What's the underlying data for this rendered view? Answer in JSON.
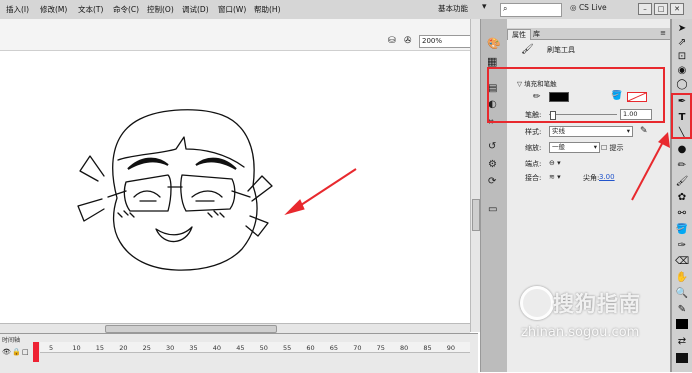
{
  "menubar": {
    "items": [
      "插入(I)",
      "修改(M)",
      "文本(T)",
      "命令(C)",
      "控制(O)",
      "调试(D)",
      "窗口(W)",
      "帮助(H)"
    ],
    "workspace_label": "基本功能",
    "cs_live": "CS Live"
  },
  "stage": {
    "zoom": "200%"
  },
  "timeline": {
    "label": "时间轴",
    "frame_ticks": [
      "5",
      "10",
      "15",
      "20",
      "25",
      "30",
      "35",
      "40",
      "45",
      "50",
      "55",
      "60",
      "65",
      "70",
      "75",
      "80",
      "85",
      "90"
    ]
  },
  "properties": {
    "tab_properties": "属性",
    "tab_library": "库",
    "tool_name": "刷笔工具",
    "fill_stroke_header": "填充和笔触",
    "fill_color": "#000000",
    "stroke_label": "笔触:",
    "stroke_value": "1.00",
    "style_label": "样式:",
    "style_value": "实线",
    "scale_label": "缩放:",
    "scale_value": "一般",
    "hint_label": "提示",
    "cap_label": "端点:",
    "join_label": "接合:",
    "miter_label": "尖角:",
    "miter_value": "3.00"
  },
  "tools": {
    "text_tool": "T"
  },
  "watermark": {
    "name": "搜狗指南",
    "url": "zhinan.sogou.com"
  },
  "colors": {
    "annotation_red": "#e8292e"
  }
}
